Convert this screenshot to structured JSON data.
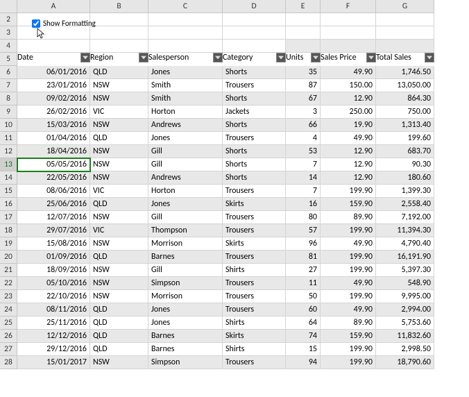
{
  "columns": [
    "A",
    "B",
    "C",
    "D",
    "E",
    "F",
    "G"
  ],
  "row_headers": [
    2,
    3,
    4,
    5,
    6,
    7,
    8,
    9,
    10,
    11,
    12,
    13,
    14,
    15,
    16,
    17,
    18,
    19,
    20,
    21,
    22,
    23,
    24,
    25,
    26,
    27,
    28
  ],
  "checkbox": {
    "label": "Show Formatting",
    "checked": true
  },
  "selected_row": 13,
  "table": {
    "headers": [
      "Date",
      "Region",
      "Salesperson",
      "Category",
      "Units",
      "Sales Price",
      "Total Sales"
    ],
    "rows": [
      {
        "date": "06/01/2016",
        "region": "QLD",
        "sales": "Jones",
        "cat": "Shorts",
        "units": "35",
        "price": "49.90",
        "total": "1,746.50"
      },
      {
        "date": "23/01/2016",
        "region": "NSW",
        "sales": "Smith",
        "cat": "Trousers",
        "units": "87",
        "price": "150.00",
        "total": "13,050.00"
      },
      {
        "date": "09/02/2016",
        "region": "NSW",
        "sales": "Smith",
        "cat": "Shorts",
        "units": "67",
        "price": "12.90",
        "total": "864.30"
      },
      {
        "date": "26/02/2016",
        "region": "VIC",
        "sales": "Horton",
        "cat": "Jackets",
        "units": "3",
        "price": "250.00",
        "total": "750.00"
      },
      {
        "date": "15/03/2016",
        "region": "NSW",
        "sales": "Andrews",
        "cat": "Shorts",
        "units": "66",
        "price": "19.90",
        "total": "1,313.40"
      },
      {
        "date": "01/04/2016",
        "region": "QLD",
        "sales": "Jones",
        "cat": "Trousers",
        "units": "4",
        "price": "49.90",
        "total": "199.60"
      },
      {
        "date": "18/04/2016",
        "region": "NSW",
        "sales": "Gill",
        "cat": "Shorts",
        "units": "53",
        "price": "12.90",
        "total": "683.70"
      },
      {
        "date": "05/05/2016",
        "region": "NSW",
        "sales": "Gill",
        "cat": "Shorts",
        "units": "7",
        "price": "12.90",
        "total": "90.30"
      },
      {
        "date": "22/05/2016",
        "region": "NSW",
        "sales": "Andrews",
        "cat": "Shorts",
        "units": "14",
        "price": "12.90",
        "total": "180.60"
      },
      {
        "date": "08/06/2016",
        "region": "VIC",
        "sales": "Horton",
        "cat": "Trousers",
        "units": "7",
        "price": "199.90",
        "total": "1,399.30"
      },
      {
        "date": "25/06/2016",
        "region": "QLD",
        "sales": "Jones",
        "cat": "Skirts",
        "units": "16",
        "price": "159.90",
        "total": "2,558.40"
      },
      {
        "date": "12/07/2016",
        "region": "NSW",
        "sales": "Gill",
        "cat": "Trousers",
        "units": "80",
        "price": "89.90",
        "total": "7,192.00"
      },
      {
        "date": "29/07/2016",
        "region": "VIC",
        "sales": "Thompson",
        "cat": "Trousers",
        "units": "57",
        "price": "199.90",
        "total": "11,394.30"
      },
      {
        "date": "15/08/2016",
        "region": "NSW",
        "sales": "Morrison",
        "cat": "Skirts",
        "units": "96",
        "price": "49.90",
        "total": "4,790.40"
      },
      {
        "date": "01/09/2016",
        "region": "QLD",
        "sales": "Barnes",
        "cat": "Trousers",
        "units": "81",
        "price": "199.90",
        "total": "16,191.90"
      },
      {
        "date": "18/09/2016",
        "region": "NSW",
        "sales": "Gill",
        "cat": "Shirts",
        "units": "27",
        "price": "199.90",
        "total": "5,397.30"
      },
      {
        "date": "05/10/2016",
        "region": "NSW",
        "sales": "Simpson",
        "cat": "Trousers",
        "units": "11",
        "price": "49.90",
        "total": "548.90"
      },
      {
        "date": "22/10/2016",
        "region": "NSW",
        "sales": "Morrison",
        "cat": "Trousers",
        "units": "50",
        "price": "199.90",
        "total": "9,995.00"
      },
      {
        "date": "08/11/2016",
        "region": "QLD",
        "sales": "Jones",
        "cat": "Trousers",
        "units": "60",
        "price": "49.90",
        "total": "2,994.00"
      },
      {
        "date": "25/11/2016",
        "region": "QLD",
        "sales": "Jones",
        "cat": "Shirts",
        "units": "64",
        "price": "89.90",
        "total": "5,753.60"
      },
      {
        "date": "12/12/2016",
        "region": "QLD",
        "sales": "Barnes",
        "cat": "Skirts",
        "units": "74",
        "price": "159.90",
        "total": "11,832.60"
      },
      {
        "date": "29/12/2016",
        "region": "QLD",
        "sales": "Barnes",
        "cat": "Shirts",
        "units": "15",
        "price": "199.90",
        "total": "2,998.50"
      },
      {
        "date": "15/01/2017",
        "region": "NSW",
        "sales": "Simpson",
        "cat": "Trousers",
        "units": "94",
        "price": "199.90",
        "total": "18,790.60"
      }
    ]
  }
}
